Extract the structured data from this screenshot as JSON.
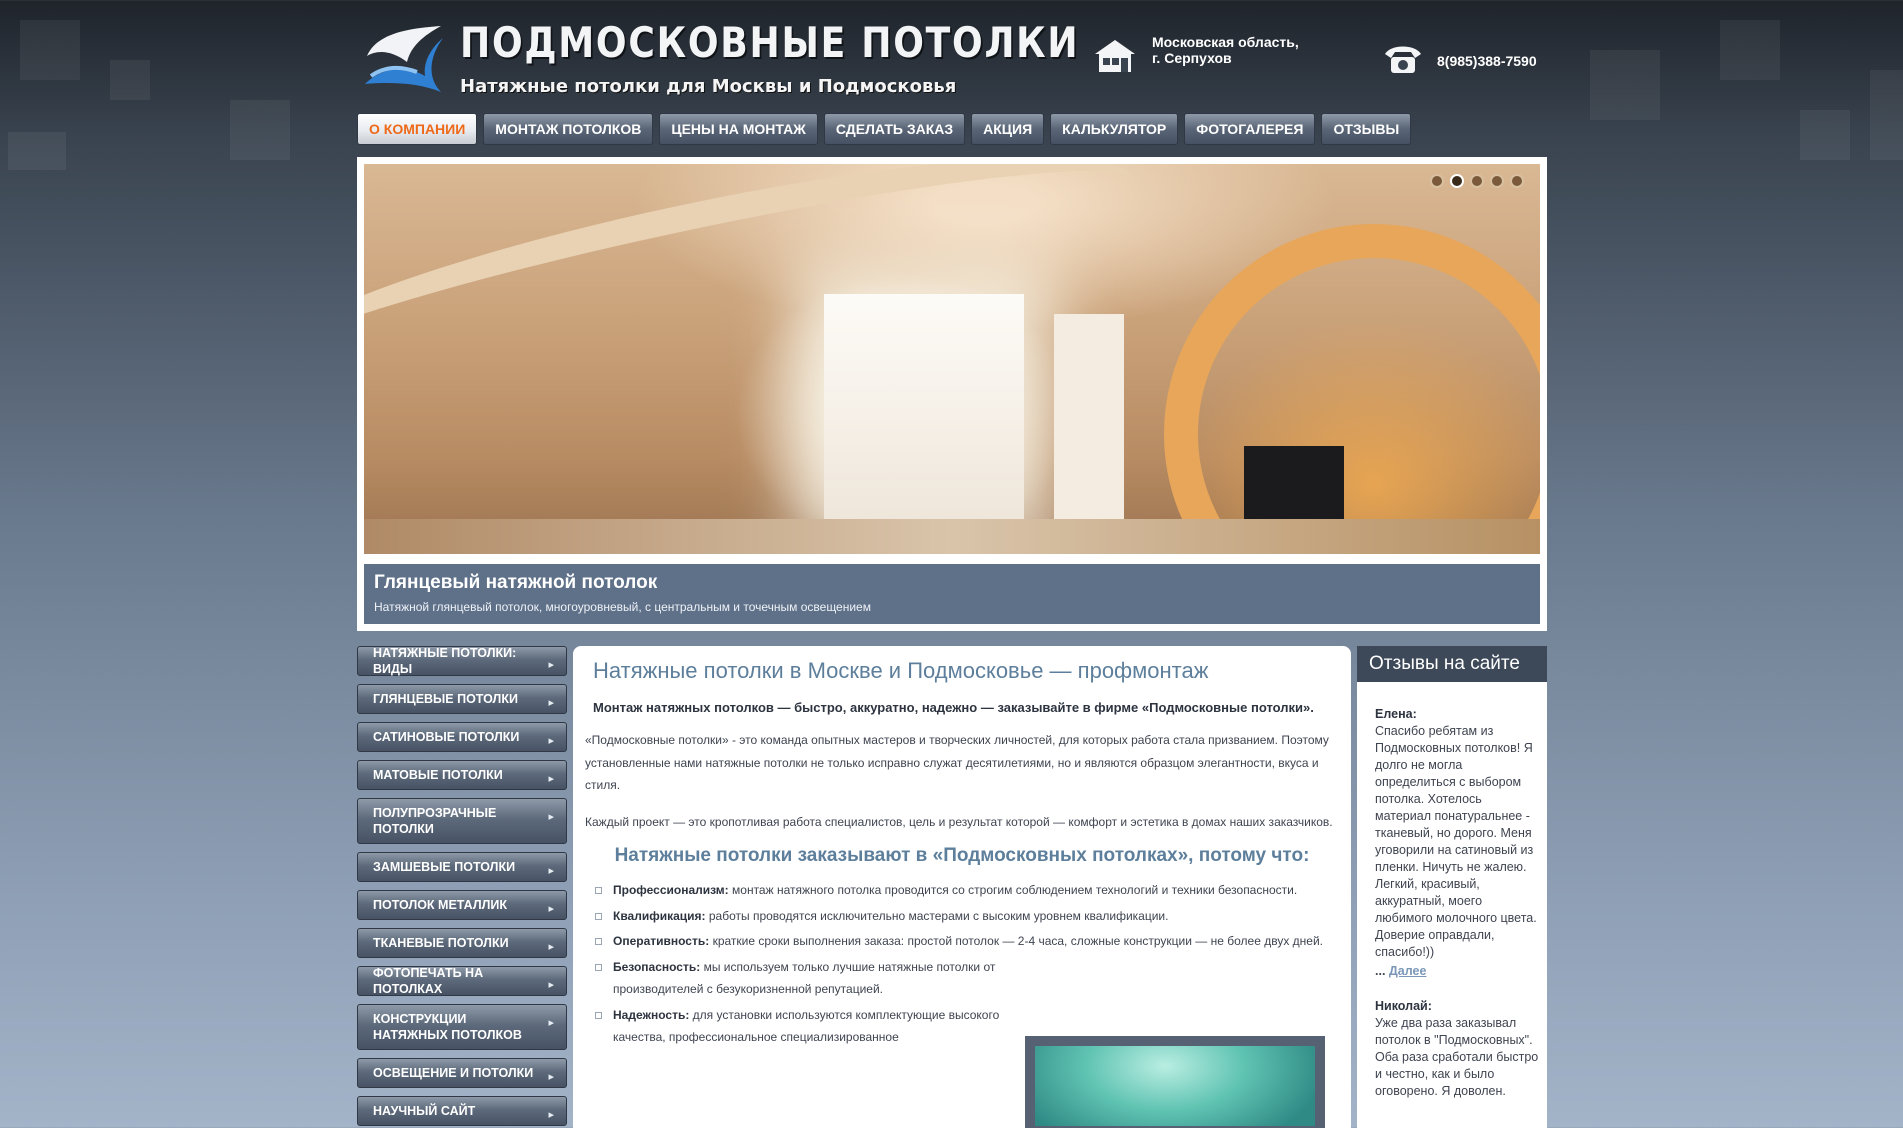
{
  "header": {
    "brand_title": "ПОДМОСКОВНЫЕ ПОТОЛКИ",
    "brand_subtitle": "Натяжные потолки для Москвы и Подмосковья",
    "address_line1": "Московская область,",
    "address_line2": "г. Серпухов",
    "phone": "8(985)388-7590",
    "icons": [
      "logo-icon",
      "house-icon",
      "phone-icon"
    ]
  },
  "nav": {
    "items": [
      {
        "label": "О КОМПАНИИ",
        "active": true
      },
      {
        "label": "МОНТАЖ ПОТОЛКОВ"
      },
      {
        "label": "ЦЕНЫ НА МОНТАЖ"
      },
      {
        "label": "СДЕЛАТЬ ЗАКАЗ"
      },
      {
        "label": "АКЦИЯ"
      },
      {
        "label": "КАЛЬКУЛЯТОР"
      },
      {
        "label": "ФОТОГАЛЕРЕЯ"
      },
      {
        "label": "ОТЗЫВЫ"
      }
    ]
  },
  "slider": {
    "caption_title": "Глянцевый натяжной потолок",
    "caption_text": "Натяжной глянцевый потолок, многоуровневый, с центральным и точечным освещением",
    "dot_count": 5,
    "active_dot": 2
  },
  "sidebar": {
    "items": [
      {
        "label": "НАТЯЖНЫЕ ПОТОЛКИ: ВИДЫ"
      },
      {
        "label": "ГЛЯНЦЕВЫЕ ПОТОЛКИ"
      },
      {
        "label": "САТИНОВЫЕ ПОТОЛКИ"
      },
      {
        "label": "МАТОВЫЕ ПОТОЛКИ"
      },
      {
        "label": "ПОЛУПРОЗРАЧНЫЕ ПОТОЛКИ"
      },
      {
        "label": "ЗАМШЕВЫЕ ПОТОЛКИ"
      },
      {
        "label": "ПОТОЛОК МЕТАЛЛИК"
      },
      {
        "label": "ТКАНЕВЫЕ ПОТОЛКИ"
      },
      {
        "label": "ФОТОПЕЧАТЬ НА ПОТОЛКАХ"
      },
      {
        "label": "КОНСТРУКЦИИ НАТЯЖНЫХ ПОТОЛКОВ"
      },
      {
        "label": "ОСВЕЩЕНИЕ И ПОТОЛКИ"
      },
      {
        "label": "НАУЧНЫЙ САЙТ"
      }
    ]
  },
  "main": {
    "title": "Натяжные потолки в Москве и Подмосковье — профмонтаж",
    "lead": "Монтаж натяжных потолков — быстро, аккуратно, надежно — заказывайте в фирме «Подмосковные потолки».",
    "para1": "«Подмосковные потолки» - это команда опытных мастеров и творческих личностей, для которых работа стала призванием. Поэтому установленные нами натяжные потолки не только исправно служат десятилетиями, но и являются образцом элегантности, вкуса и стиля.",
    "para2": "Каждый проект — это кропотливая работа специалистов, цель и результат которой — комфорт и эстетика в домах наших заказчиков.",
    "subtitle": "Натяжные потолки заказывают в «Подмосковных потолках», потому что:",
    "reasons": [
      {
        "term": "Профессионализм:",
        "text": "монтаж натяжного потолка проводится со строгим соблюдением технологий и техники безопасности."
      },
      {
        "term": "Квалификация:",
        "text": "работы проводятся исключительно мастерами с высоким уровнем квалификации."
      },
      {
        "term": "Оперативность:",
        "text": "краткие сроки выполнения заказа: простой потолок — 2-4 часа, сложные конструкции — не более двух дней."
      },
      {
        "term": "Безопасность:",
        "text": "мы используем только лучшие натяжные потолки от производителей с безукоризненной репутацией."
      },
      {
        "term": "Надежность:",
        "text": "для установки используются комплектующие высокого качества, профессиональное специализированное"
      }
    ]
  },
  "reviews": {
    "title": "Отзывы на сайте",
    "items": [
      {
        "name": "Елена:",
        "text": "Спасибо ребятам из Подмосковных потолков! Я долго не могла определиться с выбором потолка. Хотелось материал понатуральнее - тканевый, но дорого. Меня уговорили на сатиновый из пленки. Ничуть не жалею. Легкий, красивый, аккуратный, моего любимого молочного цвета. Доверие оправдали, спасибо!))",
        "more_prefix": "...",
        "more_link": "Далее"
      },
      {
        "name": "Николай:",
        "text": "Уже два раза заказывал потолок в \"Подмосковных\". Оба раза сработали быстро и честно, как и было оговорено. Я доволен."
      }
    ]
  }
}
